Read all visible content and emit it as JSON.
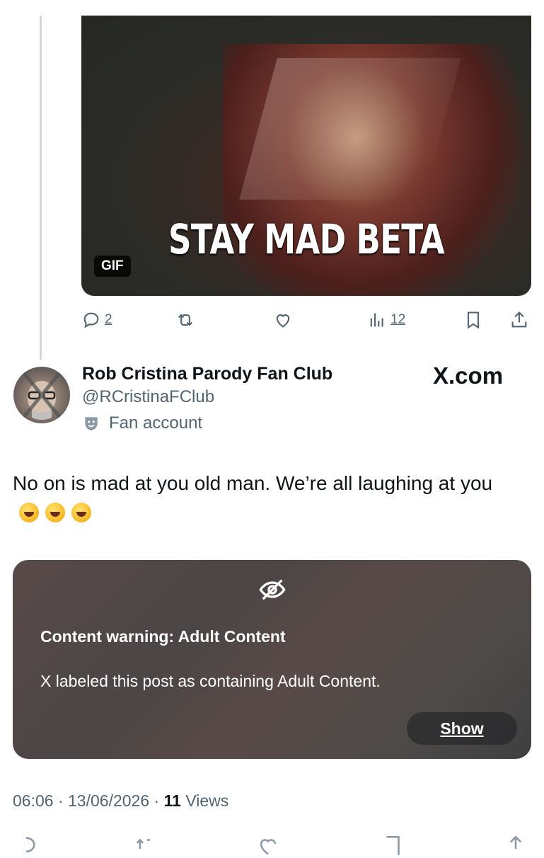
{
  "media": {
    "caption": "STAY MAD BETA",
    "badge": "GIF"
  },
  "actions": {
    "replies": "2",
    "views": "12"
  },
  "post": {
    "author_name": "Rob Cristina Parody Fan Club",
    "handle": "@RCristinaFClub",
    "account_label": "Fan account",
    "source_watermark": "X.com",
    "text": "No on is mad at you old man. We’re all laughing at you",
    "emojis": [
      "rolling-on-floor-laughing",
      "rolling-on-floor-laughing",
      "rolling-on-floor-laughing"
    ]
  },
  "content_warning": {
    "title": "Content warning: Adult Content",
    "description": "X labeled this post as containing Adult Content.",
    "show_label": "Show"
  },
  "meta": {
    "time": "06:06",
    "date": "13/06/2026",
    "views_count": "11",
    "views_label": "Views"
  },
  "colors": {
    "text_primary": "#0f1419",
    "text_secondary": "#536471",
    "thread_line": "#cfd9de"
  }
}
